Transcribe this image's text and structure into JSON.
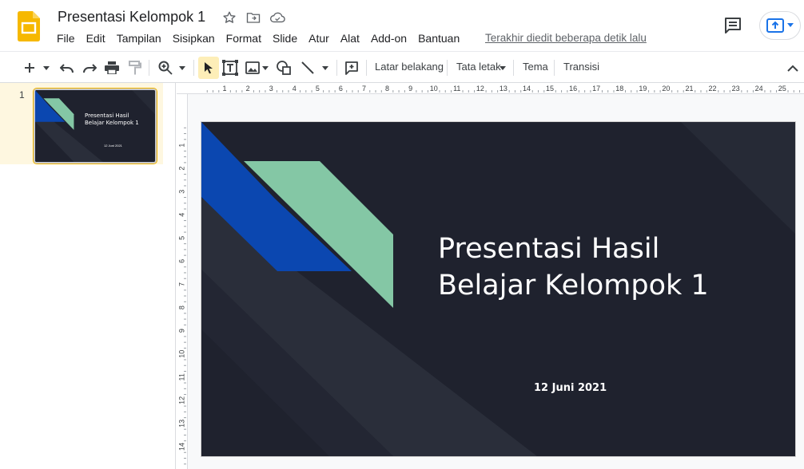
{
  "app": {
    "title": "Presentasi Kelompok 1",
    "last_edit": "Terakhir diedit beberapa detik lalu",
    "icons": {
      "star": "star-icon",
      "move": "move-to-folder-icon",
      "cloud": "cloud-status-icon",
      "comment": "comment-icon",
      "present": "present-icon"
    }
  },
  "menu": [
    "File",
    "Edit",
    "Tampilan",
    "Sisipkan",
    "Format",
    "Slide",
    "Atur",
    "Alat",
    "Add-on",
    "Bantuan"
  ],
  "toolbar": {
    "background": "Latar belakang",
    "layout": "Tata letak",
    "theme": "Tema",
    "transition": "Transisi"
  },
  "filmstrip": {
    "slides": [
      {
        "number": "1",
        "title_line1": "Presentasi Hasil",
        "title_line2": "Belajar Kelompok 1",
        "date": "12 Juni 2021"
      }
    ]
  },
  "ruler": {
    "horizontal": [
      "1",
      "2",
      "3",
      "4",
      "5",
      "6",
      "7",
      "8",
      "9",
      "10",
      "11",
      "12",
      "13",
      "14",
      "15",
      "16",
      "17",
      "18",
      "19",
      "20",
      "21",
      "22",
      "23",
      "24",
      "25"
    ],
    "vertical": [
      "1",
      "2",
      "3",
      "4",
      "5",
      "6",
      "7",
      "8",
      "9",
      "10",
      "11",
      "12",
      "13",
      "14"
    ]
  },
  "slide": {
    "title_line1": "Presentasi Hasil",
    "title_line2": "Belajar Kelompok 1",
    "date": "12 Juni 2021"
  },
  "colors": {
    "slide_bg": "#1f222e",
    "accent_blue": "#0b47b0",
    "accent_green": "#84c7a5",
    "logo_yellow": "#f6b800",
    "selection": "#fdeeb8"
  }
}
